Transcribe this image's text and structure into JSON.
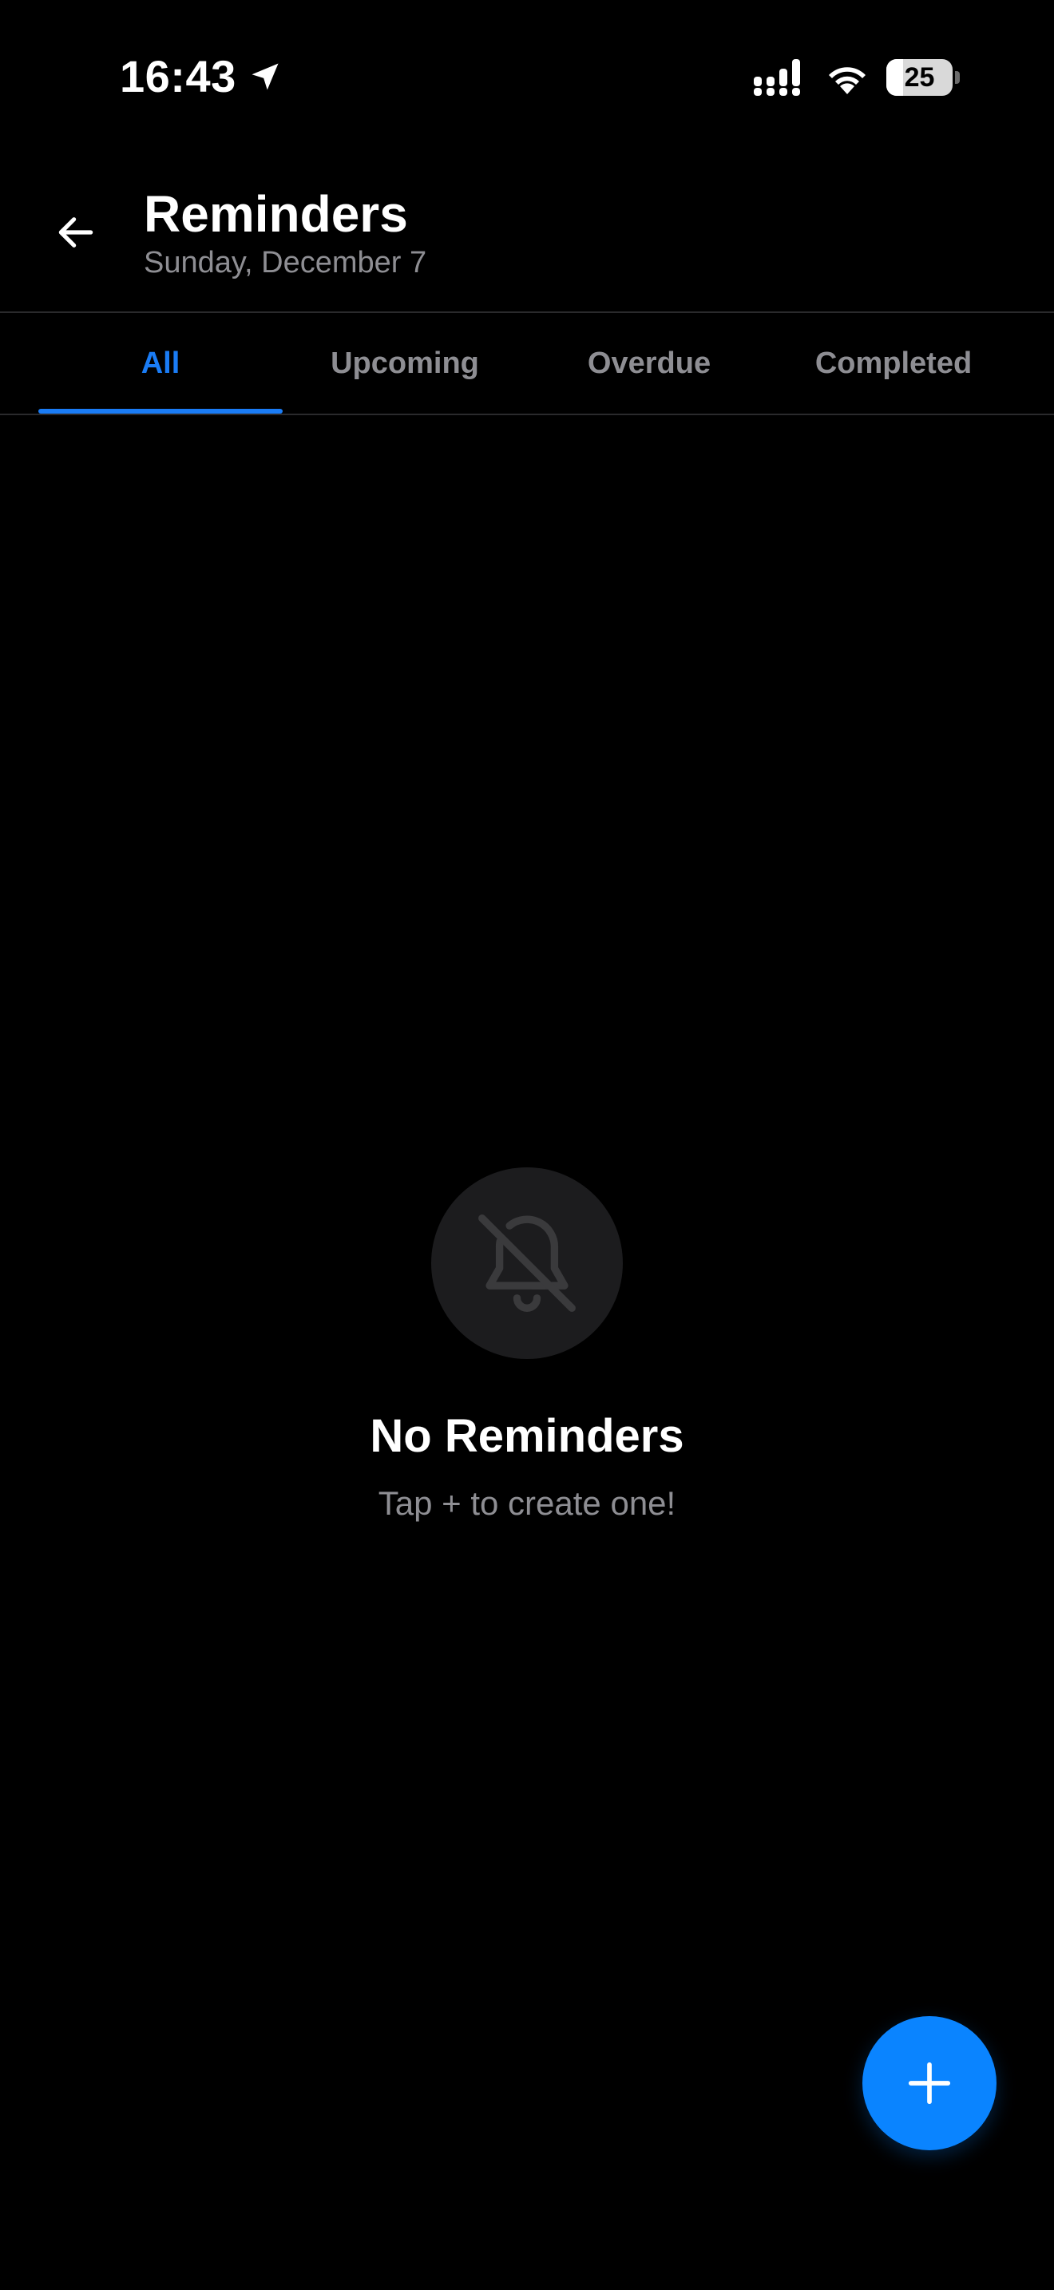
{
  "status_bar": {
    "time": "16:43",
    "battery_level": "25",
    "battery_fraction": 0.25,
    "icons": [
      "location-arrow-icon",
      "signal-icon",
      "wifi-icon",
      "battery-icon"
    ]
  },
  "header": {
    "title": "Reminders",
    "subtitle": "Sunday, December 7",
    "back_icon": "back-arrow-icon"
  },
  "tabs": [
    {
      "label": "All",
      "active": true
    },
    {
      "label": "Upcoming",
      "active": false
    },
    {
      "label": "Overdue",
      "active": false
    },
    {
      "label": "Completed",
      "active": false
    }
  ],
  "empty_state": {
    "icon": "bell-slash-icon",
    "title": "No Reminders",
    "subtitle": "Tap + to create one!"
  },
  "fab": {
    "icon": "plus-icon"
  },
  "colors": {
    "background": "#000000",
    "accent": "#1a7cf5",
    "fab": "#0a84ff",
    "secondary_text": "#8e8e93",
    "empty_circle": "#1c1c1e"
  }
}
